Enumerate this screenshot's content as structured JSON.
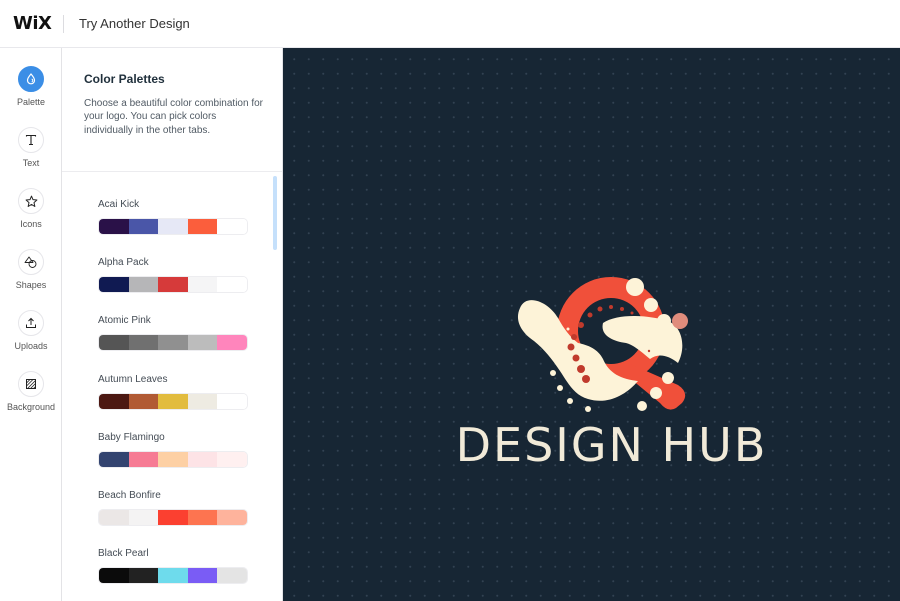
{
  "topbar": {
    "logo": "WiX",
    "title": "Try Another Design"
  },
  "rail": {
    "items": [
      {
        "label": "Palette",
        "icon": "droplet-icon",
        "active": true
      },
      {
        "label": "Text",
        "icon": "text-t-icon"
      },
      {
        "label": "Icons",
        "icon": "star-icon"
      },
      {
        "label": "Shapes",
        "icon": "shapes-icon"
      },
      {
        "label": "Uploads",
        "icon": "upload-icon"
      },
      {
        "label": "Background",
        "icon": "background-hatch-icon"
      }
    ],
    "accent": "#3b8ee6"
  },
  "panel": {
    "title": "Color Palettes",
    "description": "Choose a beautiful color combination for your logo. You can pick colors individually in the other tabs.",
    "palettes": [
      {
        "name": "Acai Kick",
        "colors": [
          "#2a1148",
          "#4a56a8",
          "#e6e8f6",
          "#fb5e3c",
          "#ffffff"
        ]
      },
      {
        "name": "Alpha Pack",
        "colors": [
          "#101a52",
          "#b6b6b8",
          "#d63a3a",
          "#f5f5f6",
          "#ffffff"
        ]
      },
      {
        "name": "Atomic Pink",
        "colors": [
          "#555555",
          "#707070",
          "#909090",
          "#bcbcbc",
          "#ff85bc"
        ]
      },
      {
        "name": "Autumn Leaves",
        "colors": [
          "#4c1812",
          "#b15a34",
          "#e2bc3e",
          "#eeebe2",
          "#ffffff"
        ]
      },
      {
        "name": "Baby Flamingo",
        "colors": [
          "#334470",
          "#f67b94",
          "#fdd0a4",
          "#fde3e6",
          "#fff0f0"
        ]
      },
      {
        "name": "Beach Bonfire",
        "colors": [
          "#ebe7e6",
          "#f4f3f3",
          "#fb4030",
          "#fd7450",
          "#feb39c"
        ]
      },
      {
        "name": "Black Pearl",
        "colors": [
          "#0b0b0b",
          "#222222",
          "#6edbec",
          "#7a5cf5",
          "#e4e4e4"
        ]
      }
    ]
  },
  "canvas": {
    "brand_text": "DESIGN HUB",
    "background": "#172634",
    "logo_colors": {
      "primary": "#f0503a",
      "cream": "#fdf3d8",
      "dots": "#c03a2c",
      "accent": "#e08c7c"
    }
  }
}
